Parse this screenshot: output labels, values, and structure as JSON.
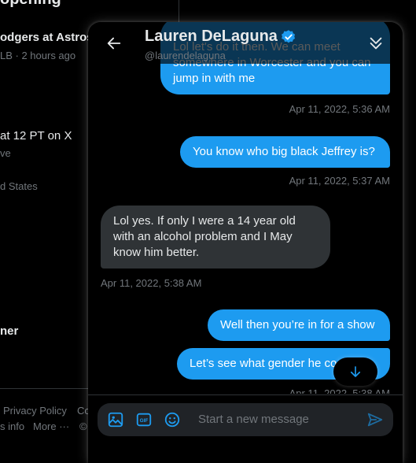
{
  "timeline": {
    "heading": "opening",
    "items": [
      {
        "title": "odgers at Astros",
        "meta": "LB · 2 hours ago"
      },
      {
        "title": "at 12 PT on X",
        "meta": "ve"
      },
      {
        "meta": "d States"
      },
      {
        "title": "ner"
      }
    ],
    "footer": {
      "privacy": "Privacy Policy",
      "cookie": "Co",
      "ads_info": "s info",
      "more": "More ···",
      "copyright": "©"
    }
  },
  "conversation": {
    "name": "Lauren DeLaguna",
    "handle": "@laurendelaguna",
    "messages": [
      {
        "direction": "out",
        "text": "Lol let's do it then. We can meet somewhere in Worcester and you can jump in with me",
        "time": "Apr 11, 2022, 5:36 AM"
      },
      {
        "direction": "out",
        "text": "You know who big black Jeffrey is?",
        "time": "Apr 11, 2022, 5:37 AM"
      },
      {
        "direction": "in",
        "text": "Lol yes. If only I were a 14 year old with an alcohol problem and I May know him better.",
        "time": "Apr 11, 2022, 5:38 AM"
      },
      {
        "direction": "out",
        "text": "Well then you’re in for a show",
        "time": ""
      },
      {
        "direction": "out",
        "text": "Let’s see what gender he co",
        "time": "Apr 11, 2022, 5:38 AM"
      }
    ]
  },
  "composer": {
    "placeholder": "Start a new message",
    "icons": [
      "media-icon",
      "gif-icon",
      "emoji-icon",
      "send-icon"
    ]
  },
  "colors": {
    "accent": "#1d9bf0",
    "incoming_bubble": "#2f3336",
    "background": "#000000"
  }
}
